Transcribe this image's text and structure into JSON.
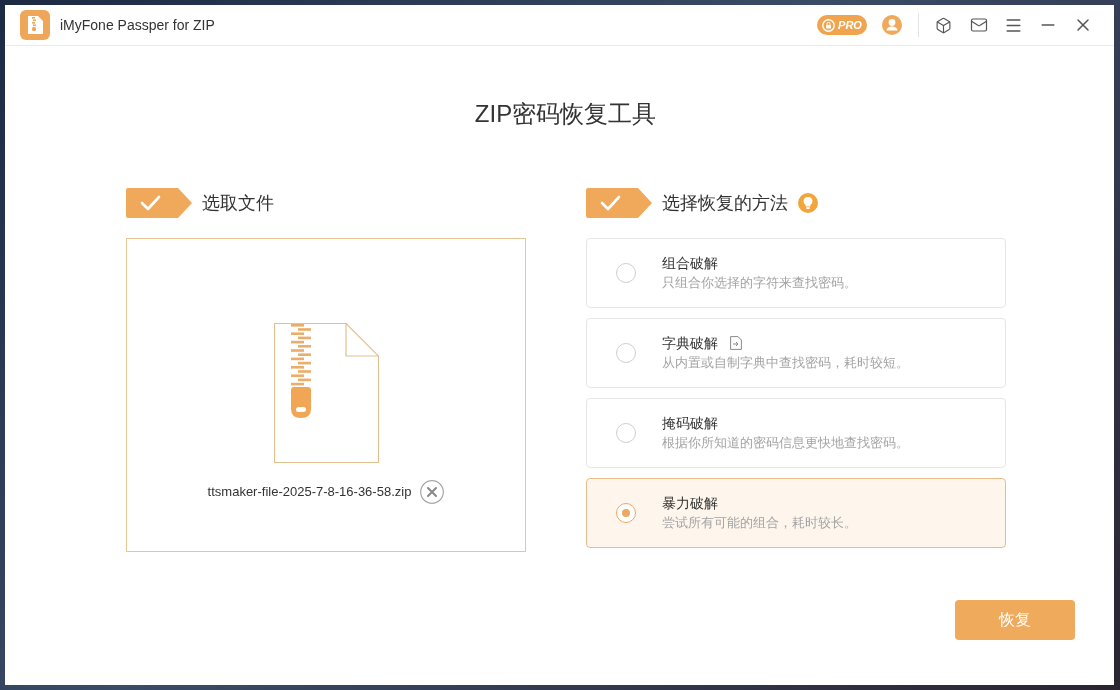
{
  "window": {
    "title": "iMyFone Passper for ZIP",
    "pro_badge": "PRO"
  },
  "heading": "ZIP密码恢复工具",
  "file_step": {
    "label": "选取文件",
    "file_name": "ttsmaker-file-2025-7-8-16-36-58.zip"
  },
  "method_step": {
    "label": "选择恢复的方法",
    "methods": [
      {
        "kind": "plain",
        "title": "组合破解",
        "description": "只组合你选择的字符来查找密码。",
        "selected": false
      },
      {
        "kind": "import",
        "title": "字典破解",
        "description": "从内置或自制字典中查找密码，耗时较短。",
        "selected": false
      },
      {
        "kind": "plain",
        "title": "掩码破解",
        "description": "根据你所知道的密码信息更快地查找密码。",
        "selected": false
      },
      {
        "kind": "plain",
        "title": "暴力破解",
        "description": "尝试所有可能的组合，耗时较长。",
        "selected": true
      }
    ]
  },
  "buttons": [
    {
      "label": "恢复"
    }
  ]
}
